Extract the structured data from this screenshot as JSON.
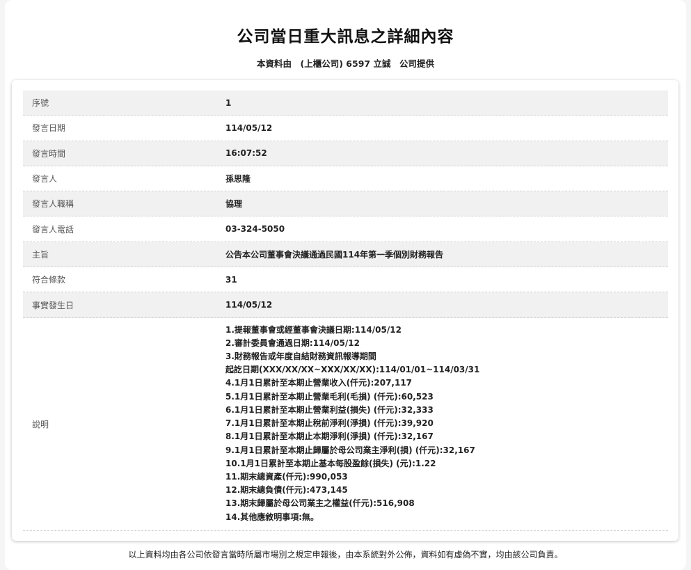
{
  "page": {
    "title": "公司當日重大訊息之詳細內容",
    "subtitle_prefix": "本資料由　(上櫃公司) 6597 立誠　公司提供"
  },
  "rows": [
    {
      "label": "序號",
      "value": "1"
    },
    {
      "label": "發言日期",
      "value": "114/05/12"
    },
    {
      "label": "發言時間",
      "value": "16:07:52"
    },
    {
      "label": "發言人",
      "value": "孫思隆"
    },
    {
      "label": "發言人職稱",
      "value": "協理"
    },
    {
      "label": "發言人電話",
      "value": "03-324-5050"
    },
    {
      "label": "主旨",
      "value": "公告本公司董事會決議通過民國114年第一季個別財務報告"
    },
    {
      "label": "符合條款",
      "value": "31"
    },
    {
      "label": "事實發生日",
      "value": "114/05/12"
    }
  ],
  "description": {
    "label": "說明",
    "lines": [
      "1.提報董事會或經董事會決議日期:114/05/12",
      "2.審計委員會通過日期:114/05/12",
      "3.財務報告或年度自結財務資訊報導期間",
      "起訖日期(XXX/XX/XX~XXX/XX/XX):114/01/01~114/03/31",
      "4.1月1日累計至本期止營業收入(仟元):207,117",
      "5.1月1日累計至本期止營業毛利(毛損) (仟元):60,523",
      "6.1月1日累計至本期止營業利益(損失) (仟元):32,333",
      "7.1月1日累計至本期止稅前淨利(淨損) (仟元):39,920",
      "8.1月1日累計至本期止本期淨利(淨損) (仟元):32,167",
      "9.1月1日累計至本期止歸屬於母公司業主淨利(損) (仟元):32,167",
      "10.1月1日累計至本期止基本每股盈餘(損失) (元):1.22",
      "11.期末總資產(仟元):990,053",
      "12.期末總負債(仟元):473,145",
      "13.期末歸屬於母公司業主之權益(仟元):516,908",
      "14.其他應敘明事項:無。"
    ]
  },
  "footer": {
    "text": "以上資料均由各公司依發言當時所屬市場別之規定申報後，由本系統對外公佈，資料如有虛偽不實，均由該公司負責。"
  }
}
